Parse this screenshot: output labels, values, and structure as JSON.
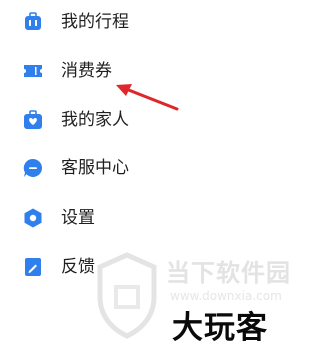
{
  "menu": {
    "items": [
      {
        "label": "我的行程",
        "icon": "itinerary-icon"
      },
      {
        "label": "消费券",
        "icon": "coupon-icon"
      },
      {
        "label": "我的家人",
        "icon": "family-icon"
      },
      {
        "label": "客服中心",
        "icon": "customer-service-icon"
      },
      {
        "label": "设置",
        "icon": "settings-icon"
      },
      {
        "label": "反馈",
        "icon": "feedback-icon"
      }
    ]
  },
  "annotation": {
    "color": "#e0262a",
    "target": "消费券"
  },
  "watermark": {
    "brand": "当下软件园",
    "url": "www.downxia.com",
    "mark": "大玩客"
  },
  "colors": {
    "icon": "#2f80ed",
    "text": "#1f1f1f"
  }
}
